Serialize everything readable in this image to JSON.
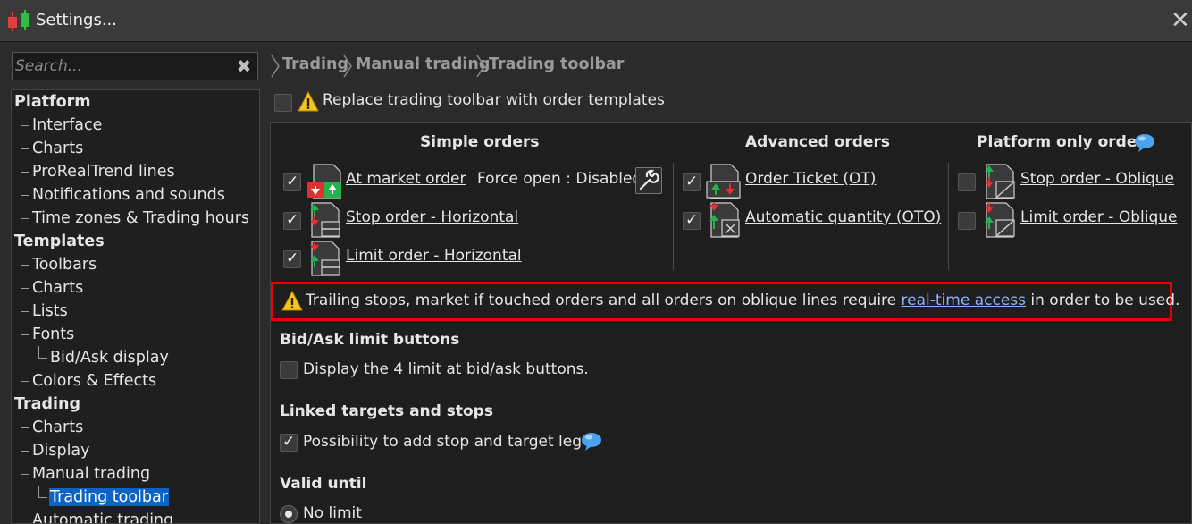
{
  "window": {
    "title": "Settings...",
    "close_glyph": "✕"
  },
  "search": {
    "placeholder": "Search...",
    "clear_glyph": "✖"
  },
  "tree": {
    "platform": "Platform",
    "interface": "Interface",
    "charts_platform": "Charts",
    "prorealtrend": "ProRealTrend lines",
    "notifications": "Notifications and sounds",
    "timezones": "Time zones & Trading hours",
    "templates": "Templates",
    "toolbars": "Toolbars",
    "charts_templates": "Charts",
    "lists": "Lists",
    "fonts": "Fonts",
    "bidask": "Bid/Ask display",
    "colors": "Colors & Effects",
    "trading": "Trading",
    "charts_trading": "Charts",
    "display": "Display",
    "manual_trading": "Manual trading",
    "trading_toolbar": "Trading toolbar",
    "automatic_trading": "Automatic trading"
  },
  "breadcrumb": [
    "Trading",
    "Manual trading",
    "Trading toolbar"
  ],
  "replace_toolbar": {
    "label": "Replace trading toolbar with order templates",
    "checked": false
  },
  "columns": {
    "simple": "Simple orders",
    "advanced": "Advanced orders",
    "platform_only": "Platform only orders"
  },
  "simple_orders": {
    "market": {
      "label": "At market order",
      "extra": "Force open : Disabled",
      "checked": true
    },
    "stop": {
      "label": "Stop order - Horizontal",
      "checked": true
    },
    "limit": {
      "label": "Limit order - Horizontal",
      "checked": true
    }
  },
  "advanced_orders": {
    "ticket": {
      "label": "Order Ticket (OT)",
      "checked": true
    },
    "auto_qty": {
      "label": "Automatic quantity (OTO)",
      "checked": true
    }
  },
  "platform_orders": {
    "stop_oblique": {
      "label": "Stop order - Oblique",
      "checked": false
    },
    "limit_oblique": {
      "label": "Limit order - Oblique",
      "checked": false
    }
  },
  "warning": {
    "before": "Trailing stops, market if touched orders and all orders on oblique lines require ",
    "link": "real-time access",
    "after": " in order to be used."
  },
  "bidask_section": {
    "heading": "Bid/Ask limit buttons",
    "option": "Display the 4 limit at bid/ask buttons.",
    "checked": false
  },
  "linked_section": {
    "heading": "Linked targets and stops",
    "option": "Possibility to add stop and target leg",
    "checked": true
  },
  "valid_until": {
    "heading": "Valid until",
    "option": "No limit",
    "selected": true
  },
  "colors": {
    "accent": "#0d63c4",
    "warning_border": "#e60000",
    "link": "#8ab4ff",
    "buy": "#22b14c",
    "sell": "#e03030"
  }
}
